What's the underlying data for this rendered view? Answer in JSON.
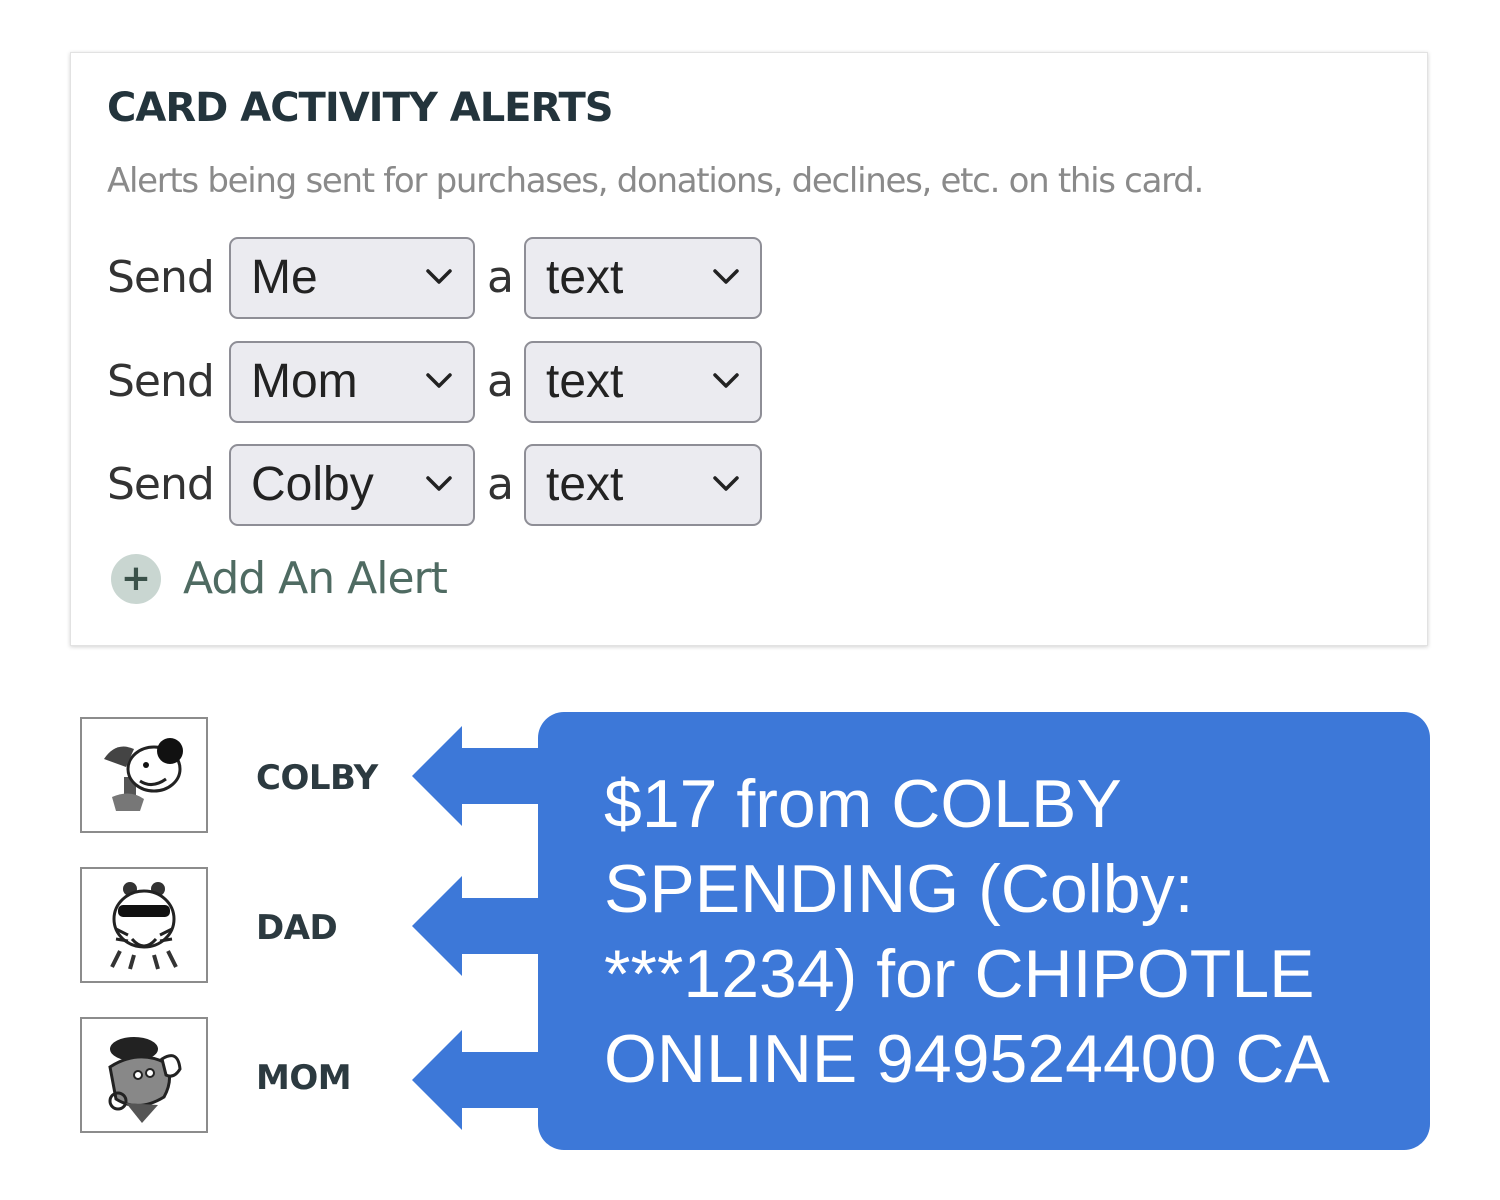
{
  "card": {
    "title": "CARD ACTIVITY ALERTS",
    "subtitle": "Alerts being sent for purchases, donations, declines, etc. on this card.",
    "send_word": "Send",
    "a_word": "a",
    "rows": [
      {
        "recipient": "Me",
        "method": "text"
      },
      {
        "recipient": "Mom",
        "method": "text"
      },
      {
        "recipient": "Colby",
        "method": "text"
      }
    ],
    "add_alert_label": "Add An Alert",
    "add_icon": "plus-circle-icon"
  },
  "people": [
    {
      "name": "COLBY",
      "avatar_icon": "dog-avatar-icon"
    },
    {
      "name": "DAD",
      "avatar_icon": "tiger-avatar-icon"
    },
    {
      "name": "MOM",
      "avatar_icon": "fox-avatar-icon"
    }
  ],
  "message": {
    "text": "$17 from COLBY SPENDING (Colby: ***1234) for CHIPOTLE ONLINE 949524400 CA"
  },
  "colors": {
    "bubble": "#3d78d8",
    "title": "#23343c",
    "add_alert": "#4f6b62",
    "select_bg": "#ebebf0"
  }
}
